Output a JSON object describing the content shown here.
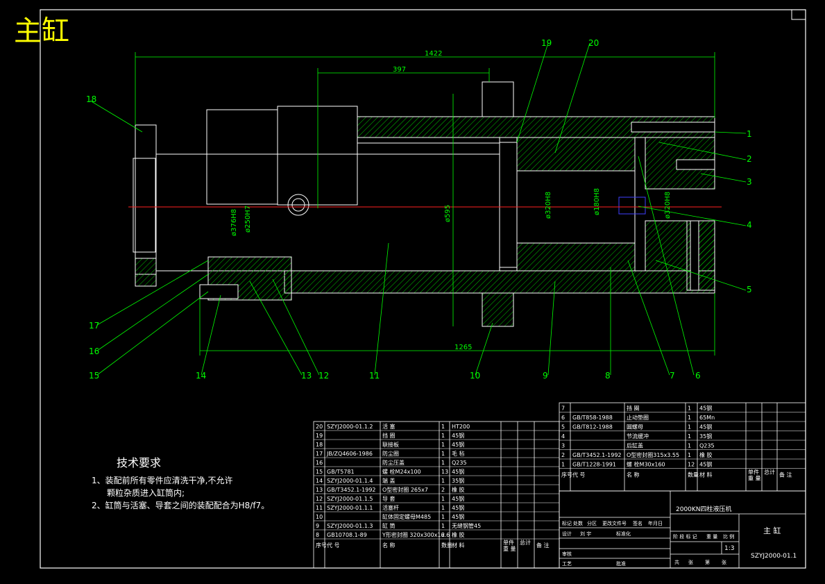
{
  "title": "主缸",
  "dimensions": {
    "total_length": "1422",
    "rod_length": "397",
    "flange_dia": "ø595",
    "body_length": "1265",
    "d376": "ø376H8",
    "d250": "ø250H7",
    "d320a": "ø320H8",
    "d180": "ø180H8",
    "d320b": "ø320H8"
  },
  "callouts": [
    "1",
    "2",
    "3",
    "4",
    "5",
    "6",
    "7",
    "8",
    "9",
    "10",
    "11",
    "12",
    "13",
    "14",
    "15",
    "16",
    "17",
    "18",
    "19",
    "20"
  ],
  "tech": {
    "heading": "技术要求",
    "line1": "1、装配前所有零件应清洗干净,不允许",
    "line2": "颗粒杂质进入缸筒内;",
    "line3": "2、缸筒与活塞、导套之间的装配配合为H8/f7。"
  },
  "bom_left": [
    [
      "20",
      "SZYJ2000-01.1.2",
      "活 塞",
      "1",
      "HT200"
    ],
    [
      "19",
      "",
      "挡 圈",
      "1",
      "45钢"
    ],
    [
      "18",
      "",
      "联接板",
      "1",
      "45钢"
    ],
    [
      "17",
      "JB/ZQ4606-1986",
      "防尘圈",
      "1",
      "毛 毡"
    ],
    [
      "16",
      "",
      "防尘压盖",
      "1",
      "Q235"
    ],
    [
      "15",
      "GB/T5781",
      "螺 栓M24x100",
      "13",
      "45钢"
    ],
    [
      "14",
      "SZYJ2000-01.1.4",
      "端 盖",
      "1",
      "35钢"
    ],
    [
      "13",
      "GB/T3452.1-1992",
      "O型密封圈 265x7",
      "2",
      "橡 胶"
    ],
    [
      "12",
      "SZYJ2000-01.1.5",
      "导 套",
      "1",
      "45钢"
    ],
    [
      "11",
      "SZYJ2000-01.1.1",
      "活塞杆",
      "1",
      "45钢"
    ],
    [
      "10",
      "",
      "缸体固定螺母M485",
      "1",
      "45钢"
    ],
    [
      "9",
      "SZYJ2000-01.1.3",
      "缸 筒",
      "1",
      "无缝钢管45"
    ],
    [
      "8",
      "GB10708.1-89",
      "Y形密封圈 320x300x16.6",
      "2",
      "橡 胶"
    ]
  ],
  "bom_left_header": [
    "序号",
    "代 号",
    "名 称",
    "数量",
    "材 料",
    "单件",
    "总计",
    "重 量",
    "备 注"
  ],
  "bom_right": [
    [
      "7",
      "",
      "挡 圈",
      "1",
      "45钢"
    ],
    [
      "6",
      "GB/T858-1988",
      "止动垫圈",
      "1",
      "65Mn"
    ],
    [
      "5",
      "GB/T812-1988",
      "圆螺母",
      "1",
      "45钢"
    ],
    [
      "4",
      "",
      "节流缓冲",
      "1",
      "35钢"
    ],
    [
      "3",
      "",
      "后缸盖",
      "1",
      "Q235"
    ],
    [
      "2",
      "GB/T3452.1-1992",
      "O型密封圈315x3.55",
      "1",
      "橡 胶"
    ],
    [
      "1",
      "GB/T1228-1991",
      "螺 栓M30x160",
      "12",
      "45钢"
    ]
  ],
  "bom_right_header": [
    "序号",
    "代 号",
    "名 称",
    "数量",
    "材 料",
    "单件",
    "总计",
    "重 量",
    "备 注"
  ],
  "title_block": {
    "project": "2000KN四柱液压机",
    "name": "主 缸",
    "drawing_no": "SZYJ2000-01.1",
    "scale": "1:3",
    "row_labels1": [
      "标记",
      "处数",
      "分区",
      "更改文件号",
      "签名",
      "年月日"
    ],
    "row_labels2": [
      "设计",
      "刘 宇",
      "",
      "标准化"
    ],
    "row_labels3": [
      "审核",
      ""
    ],
    "row_labels4": [
      "工艺",
      "",
      "批准"
    ],
    "stage_labels": [
      "阶 段 标 记",
      "重 量",
      "比 例"
    ],
    "sheet_labels": [
      "共",
      "张",
      "第",
      "张"
    ]
  },
  "colors": {
    "outline": "#ffffff",
    "hatch": "#00ff00",
    "center": "#ff0000",
    "title": "#ffff00",
    "accent": "#4040ff"
  }
}
